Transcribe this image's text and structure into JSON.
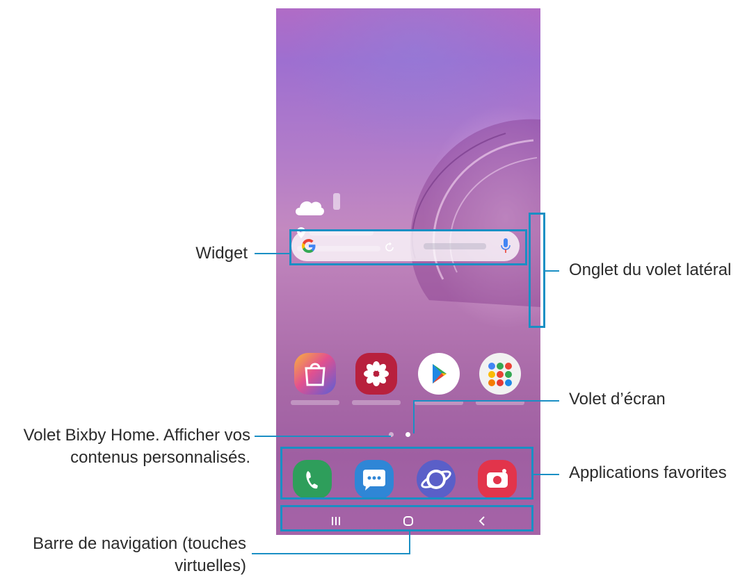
{
  "callouts": {
    "widget": "Widget",
    "side_panel_tab": "Onglet du volet latéral",
    "screen_panel": "Volet d’écran",
    "bixby_line1": "Volet Bixby Home. Afficher vos",
    "bixby_line2": "contenus personnalisés.",
    "favorite_apps": "Applications favorites",
    "nav_bar_line1": "Barre de navigation (touches",
    "nav_bar_line2": "virtuelles)"
  },
  "home_screen": {
    "apps": [
      {
        "icon": "galaxy-store-icon",
        "color": "#e2508f"
      },
      {
        "icon": "gallery-icon",
        "color": "#b8203d"
      },
      {
        "icon": "play-store-icon",
        "color": "#ffffff"
      },
      {
        "icon": "google-folder-icon",
        "color": "#f2f2f2"
      }
    ],
    "dock": [
      {
        "icon": "phone-icon",
        "color": "#2e9e5b"
      },
      {
        "icon": "messages-icon",
        "color": "#2f86d6"
      },
      {
        "icon": "internet-icon",
        "color": "#5a5fc8"
      },
      {
        "icon": "camera-icon",
        "color": "#e2344b"
      }
    ],
    "nav_buttons": [
      "recents-icon",
      "home-icon",
      "back-icon"
    ]
  },
  "colors": {
    "accent": "#1a8fc4"
  }
}
